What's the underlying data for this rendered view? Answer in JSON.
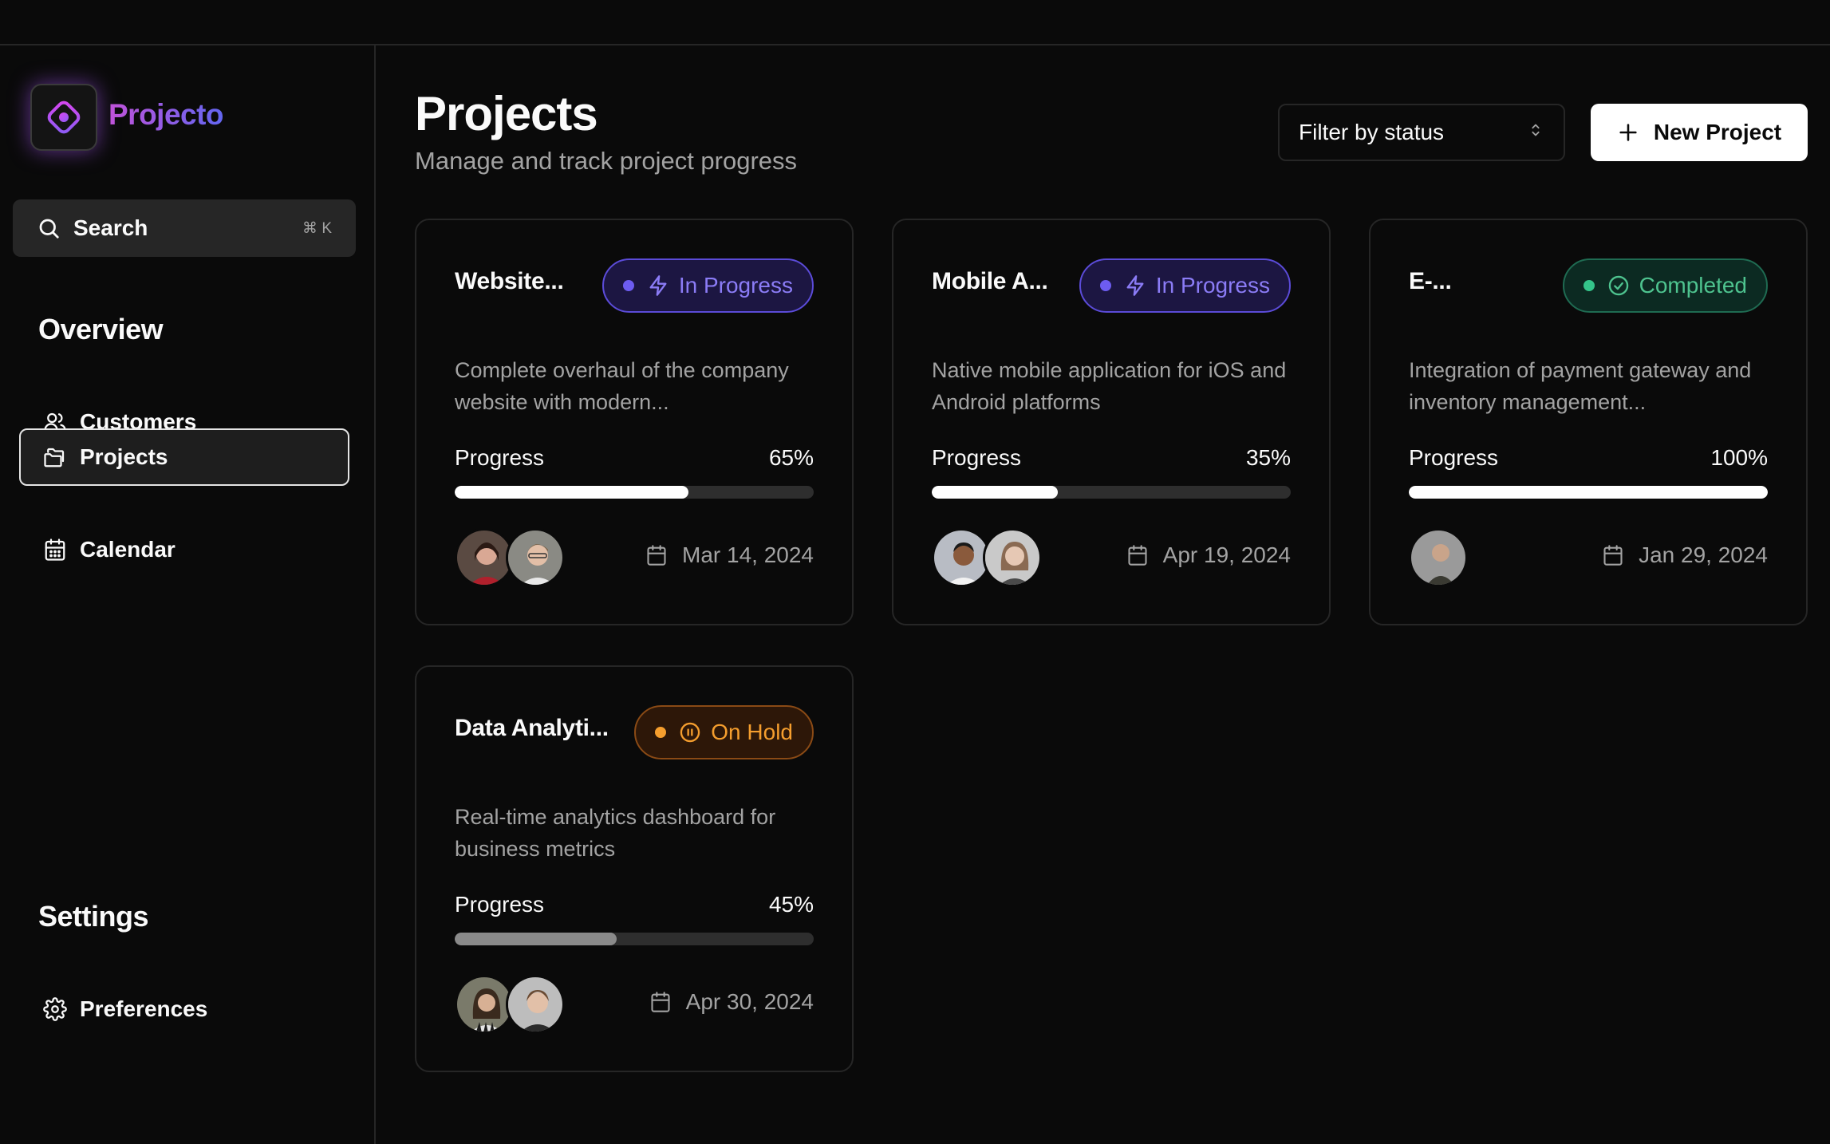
{
  "app": {
    "brand": "Projecto"
  },
  "sidebar": {
    "search_label": "Search",
    "search_shortcut": "⌘ K",
    "overview_title": "Overview",
    "items": [
      {
        "label": "Customers",
        "icon": "users-icon"
      },
      {
        "label": "Projects",
        "icon": "folder-icon",
        "active": true
      },
      {
        "label": "Calendar",
        "icon": "calendar-icon"
      }
    ],
    "settings_title": "Settings",
    "settings_items": [
      {
        "label": "Preferences",
        "icon": "gear-icon"
      }
    ]
  },
  "header": {
    "title": "Projects",
    "subtitle": "Manage and track project progress",
    "filter_label": "Filter by status",
    "new_button_label": "New Project"
  },
  "projects": [
    {
      "title": "Website...",
      "status": "In Progress",
      "description": "Complete overhaul of the company website with modern...",
      "progress_label": "Progress",
      "progress_text": "65%",
      "progress": 65,
      "date": "Mar 14, 2024",
      "avatars": 2
    },
    {
      "title": "Mobile A...",
      "status": "In Progress",
      "description": "Native mobile application for iOS and Android platforms",
      "progress_label": "Progress",
      "progress_text": "35%",
      "progress": 35,
      "date": "Apr 19, 2024",
      "avatars": 2
    },
    {
      "title": "E-...",
      "status": "Completed",
      "description": "Integration of payment gateway and inventory management...",
      "progress_label": "Progress",
      "progress_text": "100%",
      "progress": 100,
      "date": "Jan 29, 2024",
      "avatars": 1
    },
    {
      "title": "Data Analyti...",
      "status": "On Hold",
      "description": "Real-time analytics dashboard for business metrics",
      "progress_label": "Progress",
      "progress_text": "45%",
      "progress": 45,
      "date": "Apr 30, 2024",
      "avatars": 2
    }
  ],
  "colors": {
    "in_progress": "#8b7cf6",
    "completed": "#4ec38f",
    "on_hold": "#f59e2e",
    "brand_gradient_start": "#c052d8",
    "brand_gradient_end": "#6366f1"
  }
}
